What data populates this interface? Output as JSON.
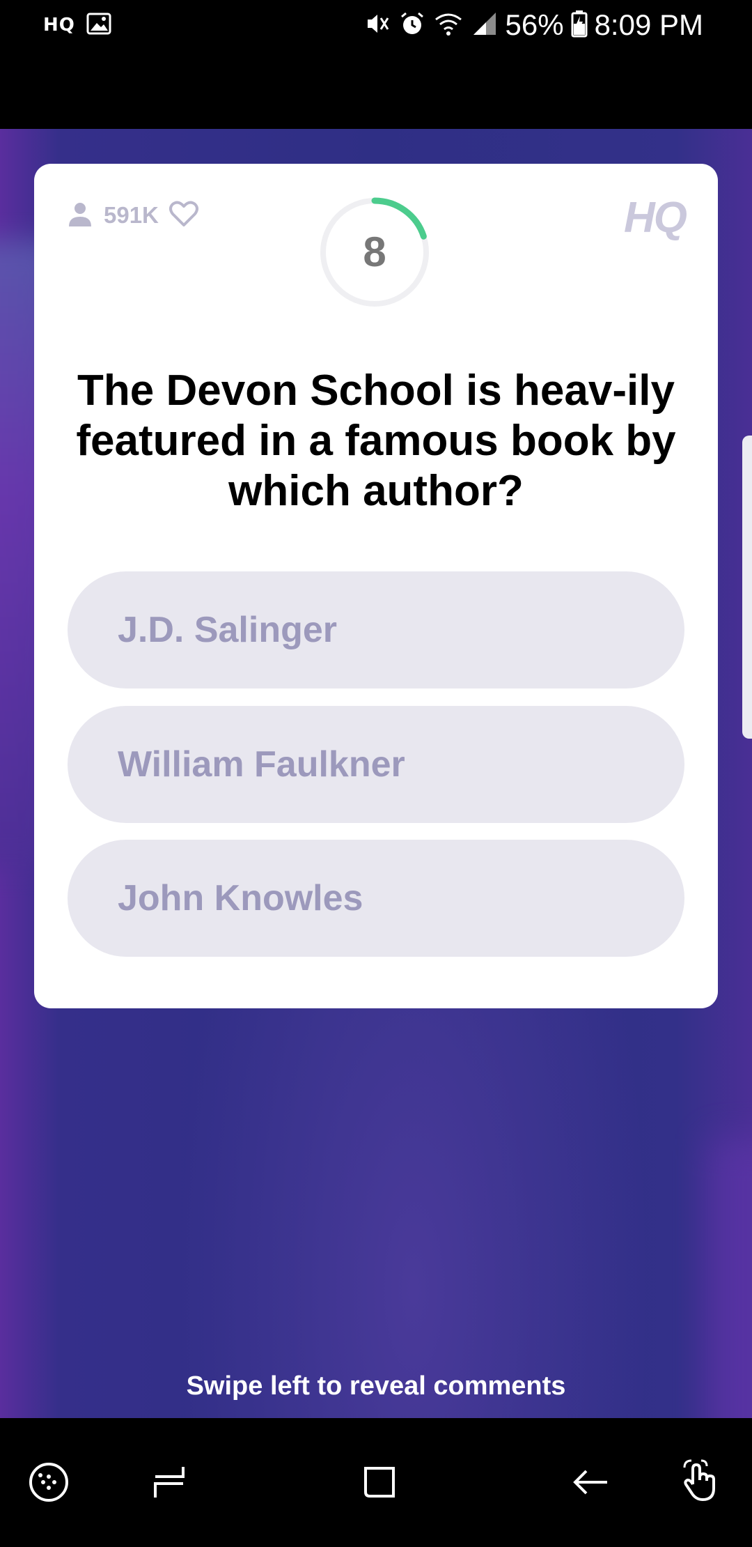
{
  "status_bar": {
    "app_label": "HQ",
    "battery": "56%",
    "time": "8:09 PM",
    "icons": [
      "image-icon",
      "mute-icon",
      "alarm-icon",
      "wifi-icon",
      "signal-icon",
      "battery-icon"
    ]
  },
  "card": {
    "viewers": "591K",
    "timer": "8",
    "timer_progress": 0.2,
    "logo": "HQ",
    "question": "The Devon School is heav-ily featured in a famous book by which author?",
    "answers": [
      {
        "label": "J.D. Salinger"
      },
      {
        "label": "William Faulkner"
      },
      {
        "label": "John Knowles"
      }
    ]
  },
  "hint": "Swipe left to reveal comments",
  "colors": {
    "accent_green": "#4ccc8d",
    "answer_bg": "#e8e7ef",
    "answer_text": "#9c99bc",
    "background": "#2f2f85"
  },
  "nav_bar": {
    "icons": [
      "game-tools-icon",
      "recent-apps-icon",
      "home-icon",
      "back-icon",
      "touch-gesture-icon"
    ]
  }
}
